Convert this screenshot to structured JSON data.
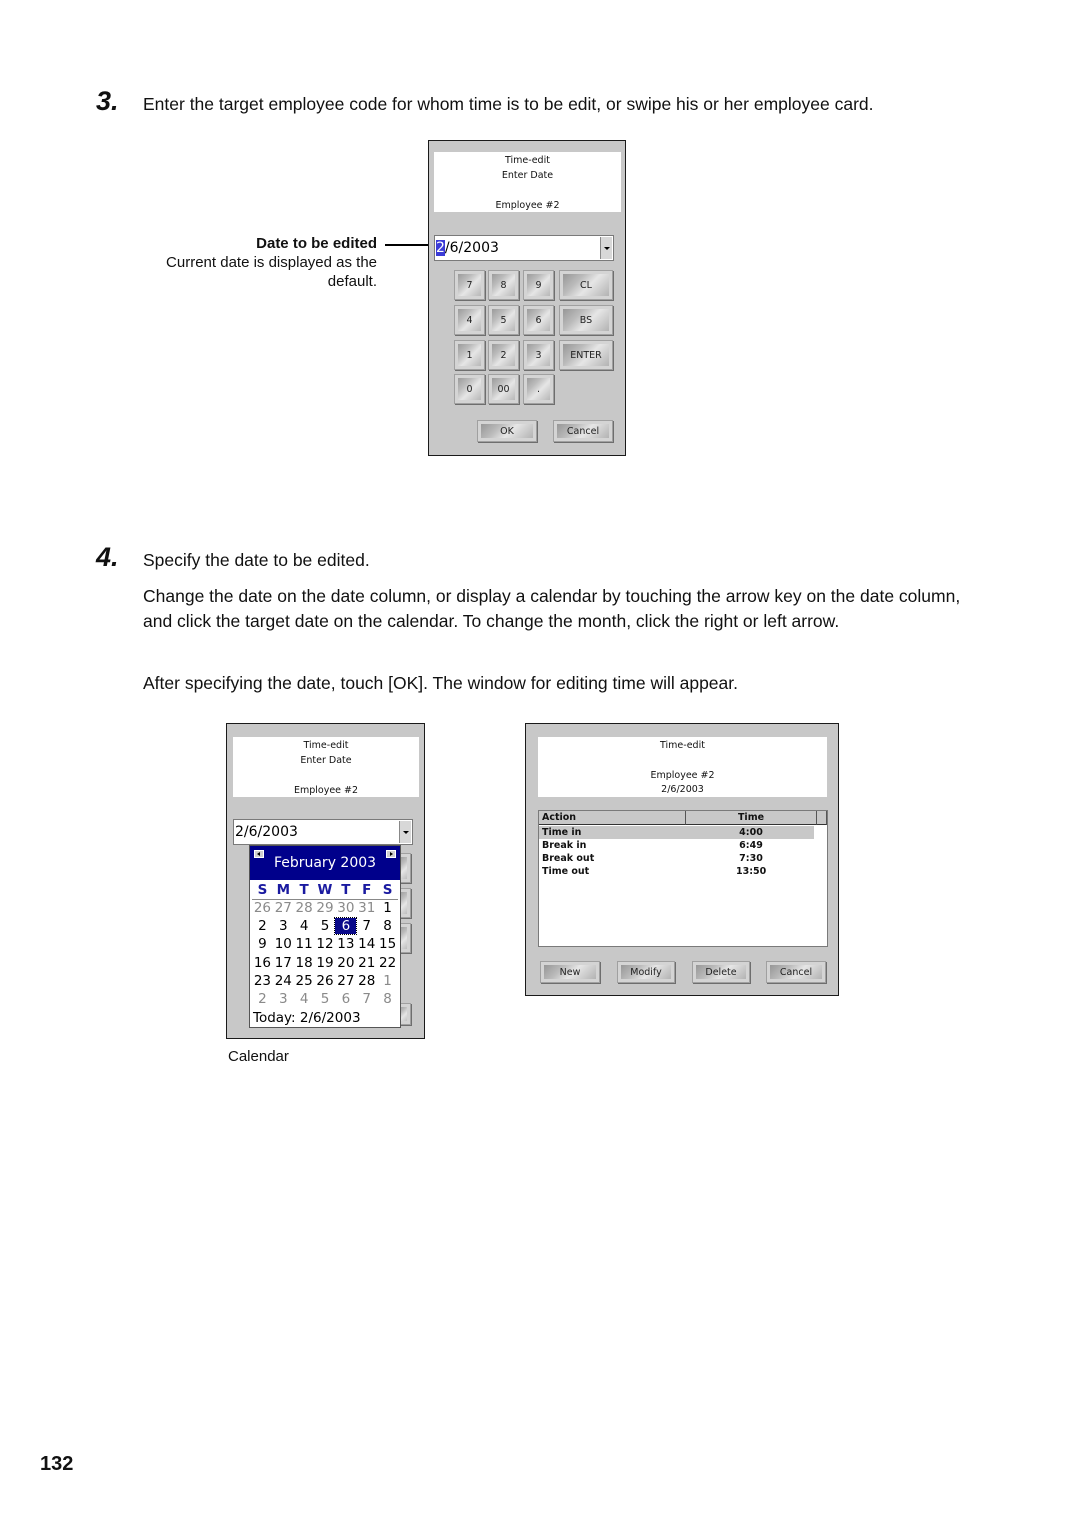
{
  "step3": {
    "number": "3.",
    "text": "Enter the target employee code for whom time is to be edit, or swipe his or her employee card.",
    "callout": {
      "title": "Date to be edited",
      "line1": "Current date is displayed as the",
      "line2": "default."
    },
    "window": {
      "header": [
        "Time-edit",
        "Enter Date",
        "Employee #2"
      ],
      "date_field": {
        "selected_char": "2",
        "rest": "/6/2003"
      },
      "keypad": [
        [
          "7",
          "8",
          "9",
          "CL"
        ],
        [
          "4",
          "5",
          "6",
          "BS"
        ],
        [
          "1",
          "2",
          "3",
          "ENTER"
        ],
        [
          "0",
          "00",
          "."
        ]
      ],
      "ok_label": "OK",
      "cancel_label": "Cancel"
    }
  },
  "step4": {
    "number": "4.",
    "text": "Specify the date to be edited.",
    "para1": "Change the date on the date column, or display a calendar by touching the arrow key on the date column, and click the target date on the calendar. To change the month, click the right or left arrow.",
    "para2": "After specifying the date, touch [OK].  The window for editing time will appear.",
    "calendar_window": {
      "header": [
        "Time-edit",
        "Enter Date",
        "Employee #2"
      ],
      "date_value": "2/6/2003",
      "calendar": {
        "month_title": "February 2003",
        "weekdays": [
          "S",
          "M",
          "T",
          "W",
          "T",
          "F",
          "S"
        ],
        "weeks": [
          [
            {
              "d": "26",
              "o": true
            },
            {
              "d": "27",
              "o": true
            },
            {
              "d": "28",
              "o": true
            },
            {
              "d": "29",
              "o": true
            },
            {
              "d": "30",
              "o": true
            },
            {
              "d": "31",
              "o": true
            },
            {
              "d": "1"
            }
          ],
          [
            {
              "d": "2"
            },
            {
              "d": "3"
            },
            {
              "d": "4"
            },
            {
              "d": "5"
            },
            {
              "d": "6",
              "s": true
            },
            {
              "d": "7"
            },
            {
              "d": "8"
            }
          ],
          [
            {
              "d": "9"
            },
            {
              "d": "10"
            },
            {
              "d": "11"
            },
            {
              "d": "12"
            },
            {
              "d": "13"
            },
            {
              "d": "14"
            },
            {
              "d": "15"
            }
          ],
          [
            {
              "d": "16"
            },
            {
              "d": "17"
            },
            {
              "d": "18"
            },
            {
              "d": "19"
            },
            {
              "d": "20"
            },
            {
              "d": "21"
            },
            {
              "d": "22"
            }
          ],
          [
            {
              "d": "23"
            },
            {
              "d": "24"
            },
            {
              "d": "25"
            },
            {
              "d": "26"
            },
            {
              "d": "27"
            },
            {
              "d": "28"
            },
            {
              "d": "1",
              "o": true
            }
          ],
          [
            {
              "d": "2",
              "o": true
            },
            {
              "d": "3",
              "o": true
            },
            {
              "d": "4",
              "o": true
            },
            {
              "d": "5",
              "o": true
            },
            {
              "d": "6",
              "o": true
            },
            {
              "d": "7",
              "o": true
            },
            {
              "d": "8",
              "o": true
            }
          ]
        ],
        "today_label": "Today: 2/6/2003"
      },
      "caption": "Calendar"
    },
    "timeedit_window": {
      "header": [
        "Time-edit",
        "",
        "Employee #2",
        "2/6/2003"
      ],
      "columns": [
        "Action",
        "Time"
      ],
      "rows": [
        {
          "action": "Time in",
          "time": "4:00"
        },
        {
          "action": "Break in",
          "time": "6:49"
        },
        {
          "action": "Break out",
          "time": "7:30"
        },
        {
          "action": "Time out",
          "time": "13:50"
        }
      ],
      "buttons": [
        "New",
        "Modify",
        "Delete",
        "Cancel"
      ]
    }
  },
  "page_number": "132"
}
